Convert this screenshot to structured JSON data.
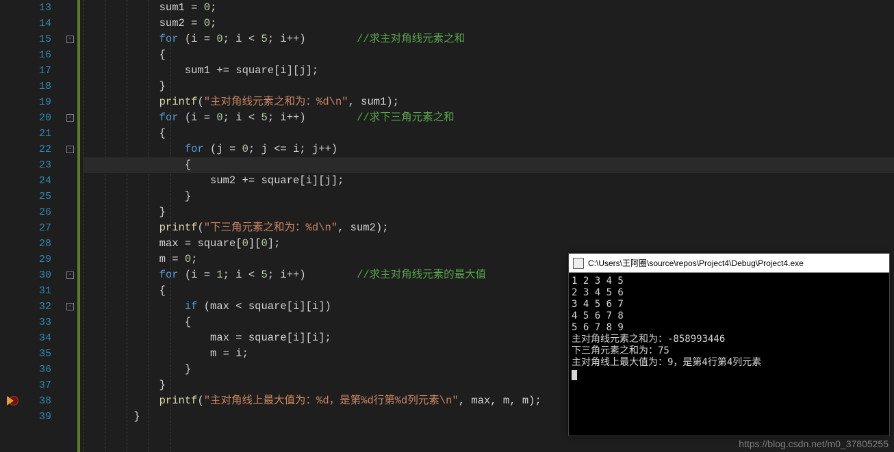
{
  "lineNumbers": [
    13,
    14,
    15,
    16,
    17,
    18,
    19,
    20,
    21,
    22,
    23,
    24,
    25,
    26,
    27,
    28,
    29,
    30,
    31,
    32,
    33,
    34,
    35,
    36,
    37,
    38,
    39
  ],
  "code": {
    "l13": {
      "indent": 3,
      "tokens": [
        [
          "id",
          "sum1"
        ],
        [
          "op",
          " = "
        ],
        [
          "num",
          "0"
        ],
        [
          "punc",
          ";"
        ]
      ]
    },
    "l14": {
      "indent": 3,
      "tokens": [
        [
          "id",
          "sum2"
        ],
        [
          "op",
          " = "
        ],
        [
          "num",
          "0"
        ],
        [
          "punc",
          ";"
        ]
      ]
    },
    "l15": {
      "indent": 3,
      "tokens": [
        [
          "kw",
          "for"
        ],
        [
          "punc",
          " ("
        ],
        [
          "id",
          "i"
        ],
        [
          "op",
          " = "
        ],
        [
          "num",
          "0"
        ],
        [
          "punc",
          "; "
        ],
        [
          "id",
          "i"
        ],
        [
          "op",
          " < "
        ],
        [
          "num",
          "5"
        ],
        [
          "punc",
          "; "
        ],
        [
          "id",
          "i"
        ],
        [
          "op",
          "++"
        ],
        [
          "punc",
          ")        "
        ],
        [
          "cmt",
          "//求主对角线元素之和"
        ]
      ]
    },
    "l16": {
      "indent": 3,
      "tokens": [
        [
          "punc",
          "{"
        ]
      ]
    },
    "l17": {
      "indent": 4,
      "tokens": [
        [
          "id",
          "sum1"
        ],
        [
          "op",
          " += "
        ],
        [
          "id",
          "square"
        ],
        [
          "punc",
          "["
        ],
        [
          "id",
          "i"
        ],
        [
          "punc",
          "]["
        ],
        [
          "id",
          "j"
        ],
        [
          "punc",
          "];"
        ]
      ]
    },
    "l18": {
      "indent": 3,
      "tokens": [
        [
          "punc",
          "}"
        ]
      ]
    },
    "l19": {
      "indent": 3,
      "tokens": [
        [
          "fn",
          "printf"
        ],
        [
          "punc",
          "("
        ],
        [
          "str",
          "\"主对角线元素之和为：%d\\n\""
        ],
        [
          "punc",
          ", "
        ],
        [
          "id",
          "sum1"
        ],
        [
          "punc",
          ");"
        ]
      ]
    },
    "l20": {
      "indent": 3,
      "tokens": [
        [
          "kw",
          "for"
        ],
        [
          "punc",
          " ("
        ],
        [
          "id",
          "i"
        ],
        [
          "op",
          " = "
        ],
        [
          "num",
          "0"
        ],
        [
          "punc",
          "; "
        ],
        [
          "id",
          "i"
        ],
        [
          "op",
          " < "
        ],
        [
          "num",
          "5"
        ],
        [
          "punc",
          "; "
        ],
        [
          "id",
          "i"
        ],
        [
          "op",
          "++"
        ],
        [
          "punc",
          ")        "
        ],
        [
          "cmt",
          "//求下三角元素之和"
        ]
      ]
    },
    "l21": {
      "indent": 3,
      "tokens": [
        [
          "punc",
          "{"
        ]
      ]
    },
    "l22": {
      "indent": 4,
      "tokens": [
        [
          "kw",
          "for"
        ],
        [
          "punc",
          " ("
        ],
        [
          "id",
          "j"
        ],
        [
          "op",
          " = "
        ],
        [
          "num",
          "0"
        ],
        [
          "punc",
          "; "
        ],
        [
          "id",
          "j"
        ],
        [
          "op",
          " <= "
        ],
        [
          "id",
          "i"
        ],
        [
          "punc",
          "; "
        ],
        [
          "id",
          "j"
        ],
        [
          "op",
          "++"
        ],
        [
          "punc",
          ")"
        ]
      ]
    },
    "l23": {
      "indent": 4,
      "tokens": [
        [
          "punc",
          "{"
        ]
      ]
    },
    "l24": {
      "indent": 5,
      "tokens": [
        [
          "id",
          "sum2"
        ],
        [
          "op",
          " += "
        ],
        [
          "id",
          "square"
        ],
        [
          "punc",
          "["
        ],
        [
          "id",
          "i"
        ],
        [
          "punc",
          "]["
        ],
        [
          "id",
          "j"
        ],
        [
          "punc",
          "];"
        ]
      ]
    },
    "l25": {
      "indent": 4,
      "tokens": [
        [
          "punc",
          "}"
        ]
      ]
    },
    "l26": {
      "indent": 3,
      "tokens": [
        [
          "punc",
          "}"
        ]
      ]
    },
    "l27": {
      "indent": 3,
      "tokens": [
        [
          "fn",
          "printf"
        ],
        [
          "punc",
          "("
        ],
        [
          "str",
          "\"下三角元素之和为：%d\\n\""
        ],
        [
          "punc",
          ", "
        ],
        [
          "id",
          "sum2"
        ],
        [
          "punc",
          ");"
        ]
      ]
    },
    "l28": {
      "indent": 3,
      "tokens": [
        [
          "id",
          "max"
        ],
        [
          "op",
          " = "
        ],
        [
          "id",
          "square"
        ],
        [
          "punc",
          "["
        ],
        [
          "num",
          "0"
        ],
        [
          "punc",
          "]["
        ],
        [
          "num",
          "0"
        ],
        [
          "punc",
          "];"
        ]
      ]
    },
    "l29": {
      "indent": 3,
      "tokens": [
        [
          "id",
          "m"
        ],
        [
          "op",
          " = "
        ],
        [
          "num",
          "0"
        ],
        [
          "punc",
          ";"
        ]
      ]
    },
    "l30": {
      "indent": 3,
      "tokens": [
        [
          "kw",
          "for"
        ],
        [
          "punc",
          " ("
        ],
        [
          "id",
          "i"
        ],
        [
          "op",
          " = "
        ],
        [
          "num",
          "1"
        ],
        [
          "punc",
          "; "
        ],
        [
          "id",
          "i"
        ],
        [
          "op",
          " < "
        ],
        [
          "num",
          "5"
        ],
        [
          "punc",
          "; "
        ],
        [
          "id",
          "i"
        ],
        [
          "op",
          "++"
        ],
        [
          "punc",
          ")        "
        ],
        [
          "cmt",
          "//求主对角线元素的最大值"
        ]
      ]
    },
    "l31": {
      "indent": 3,
      "tokens": [
        [
          "punc",
          "{"
        ]
      ]
    },
    "l32": {
      "indent": 4,
      "tokens": [
        [
          "kw",
          "if"
        ],
        [
          "punc",
          " ("
        ],
        [
          "id",
          "max"
        ],
        [
          "op",
          " < "
        ],
        [
          "id",
          "square"
        ],
        [
          "punc",
          "["
        ],
        [
          "id",
          "i"
        ],
        [
          "punc",
          "]["
        ],
        [
          "id",
          "i"
        ],
        [
          "punc",
          "])"
        ]
      ]
    },
    "l33": {
      "indent": 4,
      "tokens": [
        [
          "punc",
          "{"
        ]
      ]
    },
    "l34": {
      "indent": 5,
      "tokens": [
        [
          "id",
          "max"
        ],
        [
          "op",
          " = "
        ],
        [
          "id",
          "square"
        ],
        [
          "punc",
          "["
        ],
        [
          "id",
          "i"
        ],
        [
          "punc",
          "]["
        ],
        [
          "id",
          "i"
        ],
        [
          "punc",
          "];"
        ]
      ]
    },
    "l35": {
      "indent": 5,
      "tokens": [
        [
          "id",
          "m"
        ],
        [
          "op",
          " = "
        ],
        [
          "id",
          "i"
        ],
        [
          "punc",
          ";"
        ]
      ]
    },
    "l36": {
      "indent": 4,
      "tokens": [
        [
          "punc",
          "}"
        ]
      ]
    },
    "l37": {
      "indent": 3,
      "tokens": [
        [
          "punc",
          "}"
        ]
      ]
    },
    "l38": {
      "indent": 3,
      "tokens": [
        [
          "fn",
          "printf"
        ],
        [
          "punc",
          "("
        ],
        [
          "str",
          "\"主对角线上最大值为：%d，是第%d行第%d列元素\\n\""
        ],
        [
          "punc",
          ", "
        ],
        [
          "id",
          "max"
        ],
        [
          "punc",
          ", "
        ],
        [
          "id",
          "m"
        ],
        [
          "punc",
          ", "
        ],
        [
          "id",
          "m"
        ],
        [
          "punc",
          ");"
        ]
      ]
    },
    "l39": {
      "indent": 2,
      "tokens": [
        [
          "punc",
          "}"
        ]
      ]
    }
  },
  "foldMarks": [
    15,
    20,
    22,
    30,
    32
  ],
  "highlightLine": 23,
  "breakpointLine": 38,
  "console": {
    "title": "C:\\Users\\王阿圈\\source\\repos\\Project4\\Debug\\Project4.exe",
    "lines": [
      "1 2 3 4 5",
      "2 3 4 5 6",
      "3 4 5 6 7",
      "4 5 6 7 8",
      "5 6 7 8 9",
      "主对角线元素之和为：-858993446",
      "下三角元素之和为：75",
      "主对角线上最大值为：9，是第4行第4列元素"
    ]
  },
  "watermark": "https://blog.csdn.net/m0_37805255"
}
